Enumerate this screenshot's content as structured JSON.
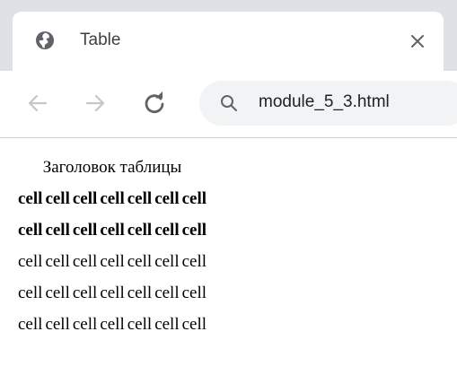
{
  "browser": {
    "tab": {
      "title": "Table",
      "favicon": "globe-icon",
      "close_icon": "close-icon"
    },
    "toolbar": {
      "back_icon": "back-arrow-icon",
      "forward_icon": "forward-arrow-icon",
      "reload_icon": "reload-icon"
    },
    "omnibox": {
      "search_icon": "search-icon",
      "url": "module_5_3.html"
    }
  },
  "page": {
    "caption": "Заголовок таблицы",
    "header_rows": [
      [
        "cell",
        "cell",
        "cell",
        "cell",
        "cell",
        "cell",
        "cell"
      ],
      [
        "cell",
        "cell",
        "cell",
        "cell",
        "cell",
        "cell",
        "cell"
      ]
    ],
    "body_rows": [
      [
        "cell",
        "cell",
        "cell",
        "cell",
        "cell",
        "cell",
        "cell"
      ],
      [
        "cell",
        "cell",
        "cell",
        "cell",
        "cell",
        "cell",
        "cell"
      ],
      [
        "cell",
        "cell",
        "cell",
        "cell",
        "cell",
        "cell",
        "cell"
      ]
    ]
  }
}
